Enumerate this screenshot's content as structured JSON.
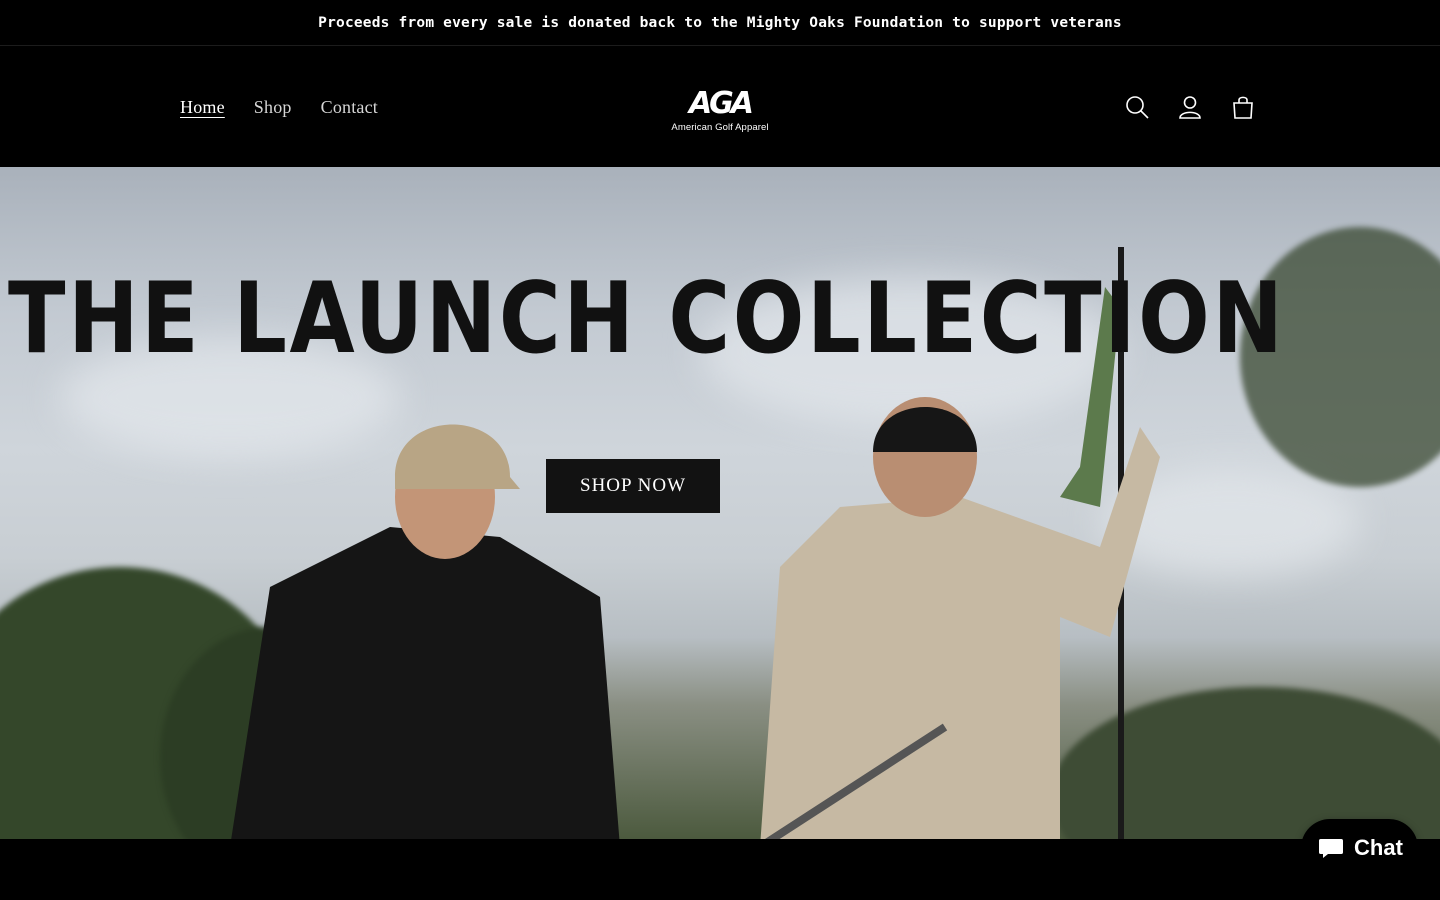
{
  "announcement": {
    "text": "Proceeds from every sale is donated back to the Mighty Oaks Foundation to support veterans"
  },
  "header": {
    "nav": [
      {
        "label": "Home",
        "active": true
      },
      {
        "label": "Shop",
        "active": false
      },
      {
        "label": "Contact",
        "active": false
      }
    ],
    "logo": {
      "mark": "AGA",
      "subtitle": "American Golf Apparel"
    },
    "icons": [
      "search-icon",
      "account-icon",
      "cart-icon"
    ]
  },
  "hero": {
    "title": "THE LAUNCH COLLECTION",
    "cta_label": "SHOP NOW"
  },
  "chat": {
    "label": "Chat"
  },
  "colors": {
    "background": "#000000",
    "button": "#121212",
    "text": "#ffffff"
  }
}
